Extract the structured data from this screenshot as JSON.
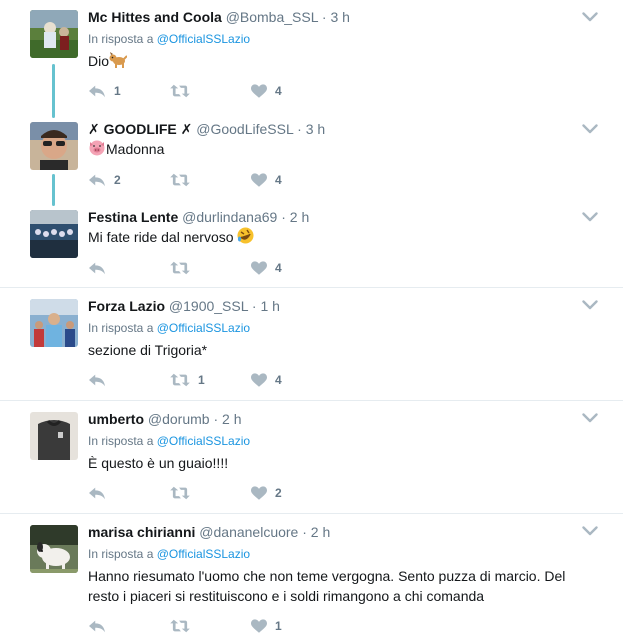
{
  "tweets": [
    {
      "name": "Mc Hittes and Coola",
      "handle": "@Bomba_SSL",
      "time": "3 h",
      "reply_prefix": "In risposta a",
      "reply_to": "@OfficialSSLazio",
      "text": "Dio",
      "emoji": "dog",
      "replies": "1",
      "retweets": "",
      "likes": "4"
    },
    {
      "name": "✗ GOODLIFE ✗",
      "handle": "@GoodLifeSSL",
      "time": "3 h",
      "text": "Madonna",
      "emoji": "pig",
      "replies": "2",
      "retweets": "",
      "likes": "4"
    },
    {
      "name": "Festina Lente",
      "handle": "@durlindana69",
      "time": "2 h",
      "text": "Mi fate ride dal nervoso",
      "emoji": "laughing",
      "replies": "",
      "retweets": "",
      "likes": "4"
    },
    {
      "name": "Forza Lazio",
      "handle": "@1900_SSL",
      "time": "1 h",
      "reply_prefix": "In risposta a",
      "reply_to": "@OfficialSSLazio",
      "text": "sezione di Trigoria*",
      "replies": "",
      "retweets": "1",
      "likes": "4"
    },
    {
      "name": "umberto",
      "handle": "@dorumb",
      "time": "2 h",
      "reply_prefix": "In risposta a",
      "reply_to": "@OfficialSSLazio",
      "text": "È questo è un guaio!!!!",
      "replies": "",
      "retweets": "",
      "likes": "2"
    },
    {
      "name": "marisa chirianni",
      "handle": "@dananelcuore",
      "time": "2 h",
      "reply_prefix": "In risposta a",
      "reply_to": "@OfficialSSLazio",
      "text_line1": "Hanno riesumato l'uomo che non teme vergogna. Sento puzza di marcio. Del",
      "text_line2": "resto i piaceri si restituiscono e i soldi rimangono a chi comanda",
      "replies": "",
      "retweets": "",
      "likes": "1"
    }
  ],
  "colors": {
    "thread_line": "#66c2cf",
    "link": "#1b95e0",
    "muted": "#657786",
    "divider": "#e6ecf0",
    "icon": "#aab8c2"
  },
  "icons": {
    "reply": "reply-icon",
    "retweet": "retweet-icon",
    "like": "heart-icon",
    "more": "chevron-down-icon"
  }
}
